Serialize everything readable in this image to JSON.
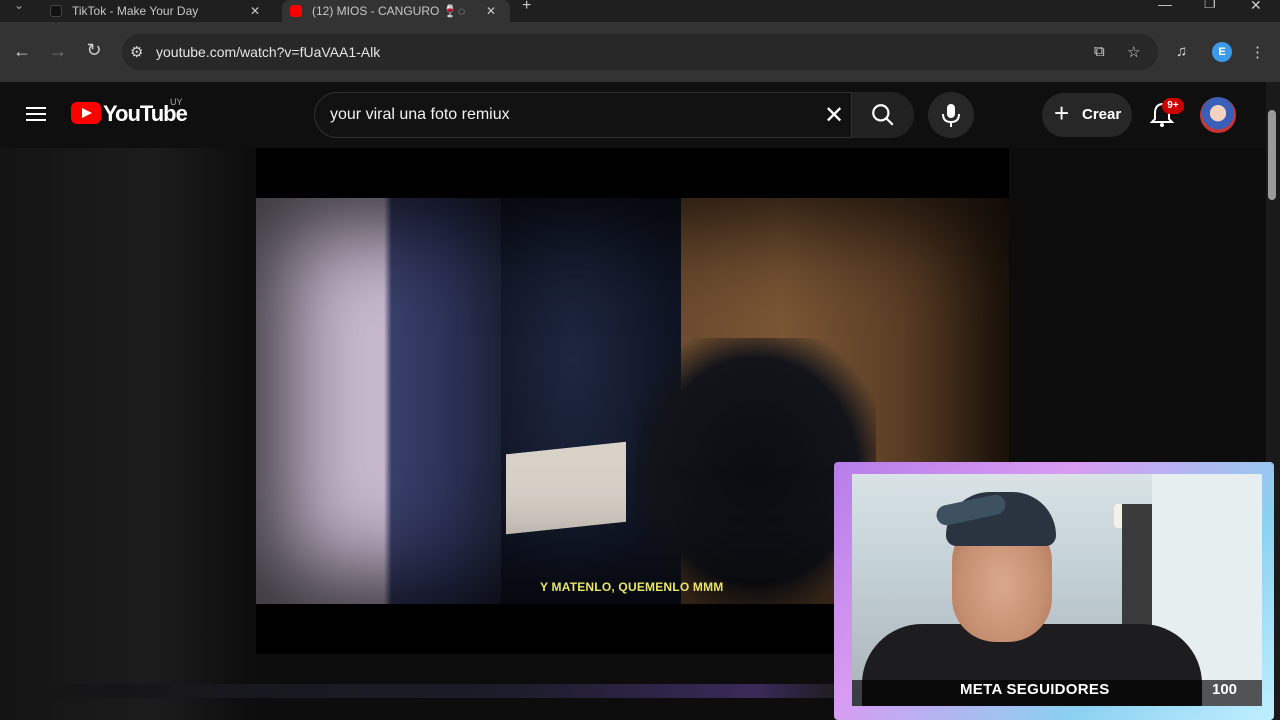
{
  "browser": {
    "tabs": [
      {
        "label": "TikTok - Make Your Day",
        "color": "#111111"
      },
      {
        "label": "(12) MIOS - CANGURO 🍷",
        "color": "#ff0000"
      }
    ],
    "url": "youtube.com/watch?v=fUaVAA1-Alk",
    "extension_initial": "E",
    "icons": [
      "back-icon",
      "forward-icon",
      "reload-icon",
      "site-info-icon",
      "install-icon",
      "bookmark-star-icon",
      "media-icon",
      "menu-dots-icon"
    ]
  },
  "youtube": {
    "logo_text": "YouTube",
    "country_code": "UY",
    "search_query": "your viral una foto remiux",
    "create_label": "Crear",
    "notification_badge": "9+"
  },
  "video": {
    "subtitle": "Y MATENLO, QUEMENLO MMM"
  },
  "overlay": {
    "goal_label": "META SEGUIDORES",
    "goal_value": "100"
  },
  "colors": {
    "brand": "#ff0000",
    "subtitle": "#e8e46a",
    "cam_border_start": "#b77de8",
    "cam_border_end": "#bfefff"
  }
}
